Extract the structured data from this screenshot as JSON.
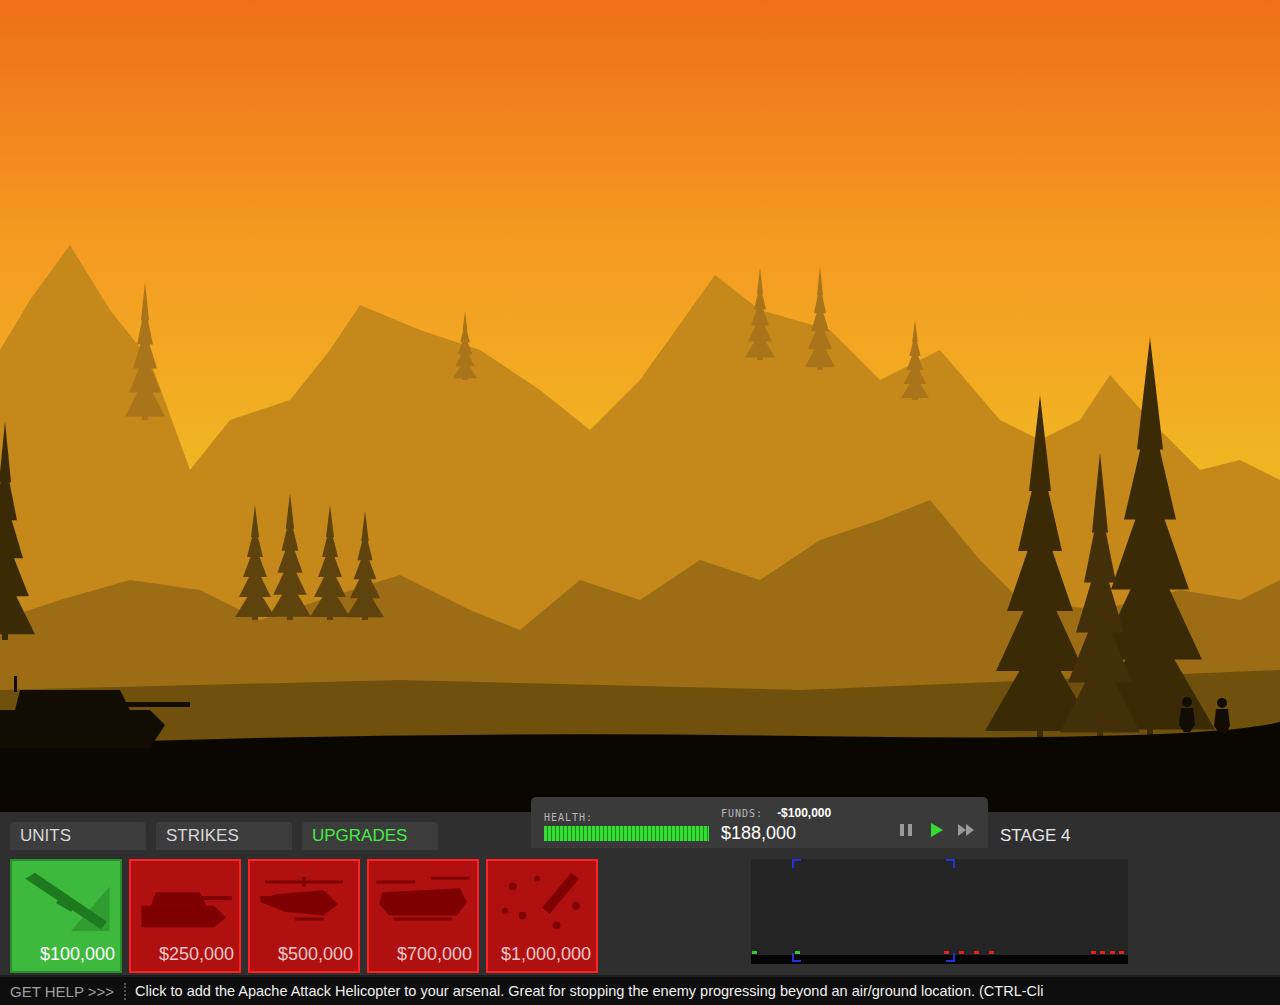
{
  "tabs": [
    {
      "label": "UNITS",
      "selected": false
    },
    {
      "label": "STRIKES",
      "selected": false
    },
    {
      "label": "UPGRADES",
      "selected": true
    }
  ],
  "status": {
    "health_label": "HEALTH:",
    "health_level": 1,
    "funds_label": "FUNDS:",
    "funds_change": "-$100,000",
    "funds": "$188,000",
    "controls": [
      {
        "name": "pause",
        "selected": false
      },
      {
        "name": "play",
        "selected": true
      },
      {
        "name": "fast-forward",
        "selected": false
      }
    ]
  },
  "stage": "STAGE 4",
  "upgrades": [
    {
      "kind": "rocket",
      "price": "$100,000",
      "available": true
    },
    {
      "kind": "tank",
      "price": "$250,000",
      "available": false
    },
    {
      "kind": "apache",
      "price": "$500,000",
      "available": false
    },
    {
      "kind": "chinook",
      "price": "$700,000",
      "available": false
    },
    {
      "kind": "airstrike",
      "price": "$1,000,000",
      "available": false
    }
  ],
  "minimap": {
    "viewport": [
      0.11,
      0.54
    ],
    "markers": [
      {
        "at": 0.01,
        "color": "#33cc33"
      },
      {
        "at": 0.125,
        "color": "#33cc33"
      },
      {
        "at": 0.52,
        "color": "#dd2222"
      },
      {
        "at": 0.56,
        "color": "#dd2222"
      },
      {
        "at": 0.6,
        "color": "#dd2222"
      },
      {
        "at": 0.64,
        "color": "#dd2222"
      },
      {
        "at": 0.91,
        "color": "#dd2222"
      },
      {
        "at": 0.935,
        "color": "#dd2222"
      },
      {
        "at": 0.96,
        "color": "#dd2222"
      },
      {
        "at": 0.985,
        "color": "#dd2222"
      }
    ]
  },
  "help": {
    "button": "GET HELP >>>",
    "message": "Click to add the Apache Attack Helicopter to your arsenal. Great for stopping the enemy progressing beyond an air/ground location. (CTRL-Cli"
  }
}
